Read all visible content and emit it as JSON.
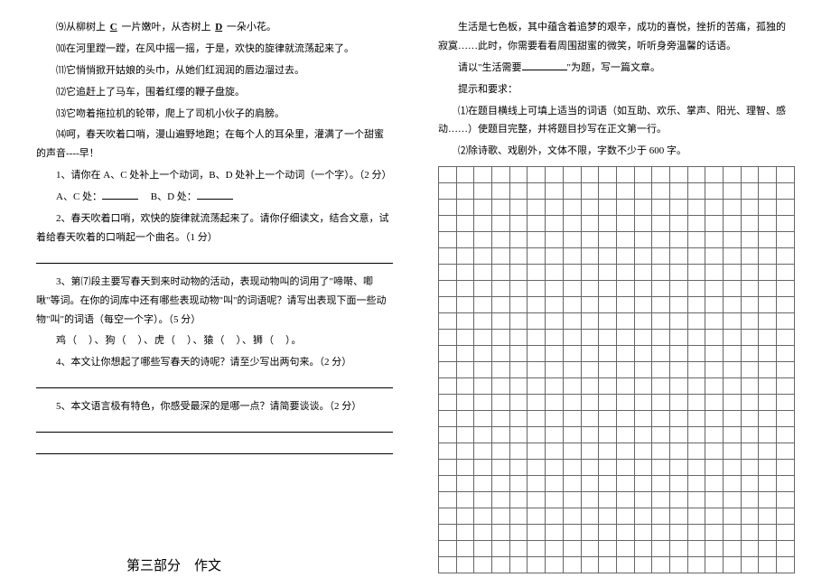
{
  "left": {
    "p1_a": "⑼从柳树上",
    "p1_c": "C",
    "p1_b": "一片嫩叶，从杏树上",
    "p1_d": "D",
    "p1_e": "一朵小花。",
    "p2": "⑽在河里蹚一蹚，在风中摇一摇，于是，欢快的旋律就流荡起来了。",
    "p3": "⑾它悄悄掀开姑娘的头巾，从她们红润润的唇边溜过去。",
    "p4": "⑿它追赶上了马车，围着红缨的鞭子盘旋。",
    "p5": "⒀它吻着拖拉机的轮带，爬上了司机小伙子的肩膀。",
    "p6": "⒁呵，春天吹着口哨，漫山遍野地跑；在每个人的耳朵里，灌满了一个甜蜜的声音----早！",
    "q1": "1、请你在 A、C 处补上一个动词，B、D 处补上一个动词（一个字）。（2 分）",
    "q1_ac": "A、C 处：",
    "q1_bd": "B、D 处：",
    "q2": "2、春天吹着口哨，欢快的旋律就流荡起来了。请你仔细读文，结合文意，试着给春天吹着的口哨起一个曲名。（1 分）",
    "q3": "3、第⑺段主要写春天到来时动物的活动，表现动物叫的词用了\"啼啭、唧啾\"等词。在你的词库中还有哪些表现动物\"叫\"的词语呢？请写出表现下面一些动物\"叫\"的词语（每空一个字）。（5 分）",
    "q3_list": "鸡（　）、狗（　）、虎（　）、猿（　）、狮（　）。",
    "q4": "4、本文让你想起了哪些写春天的诗呢？请至少写出两句来。（2 分）",
    "q5": "5、本文语言极有特色，你感受最深的是哪一点？请简要谈谈。（2 分）",
    "section3": "第三部分　作文"
  },
  "right": {
    "intro1": "生活是七色板，其中蕴含着追梦的艰辛，成功的喜悦，挫折的苦痛，孤独的寂寞……此时，你需要看看周围甜蜜的微笑，听听身旁温馨的话语。",
    "intro2_a": "请以\"生活需要",
    "intro2_b": "\"为题，写一篇文章。",
    "hint_label": "提示和要求：",
    "hint1": "⑴在题目横线上可填上适当的词语（如互助、欢乐、掌声、阳光、理智、感动……）使题目完整，并将题目抄写在正文第一行。",
    "hint2": "⑵除诗歌、戏剧外，文体不限，字数不少于 600 字。"
  }
}
